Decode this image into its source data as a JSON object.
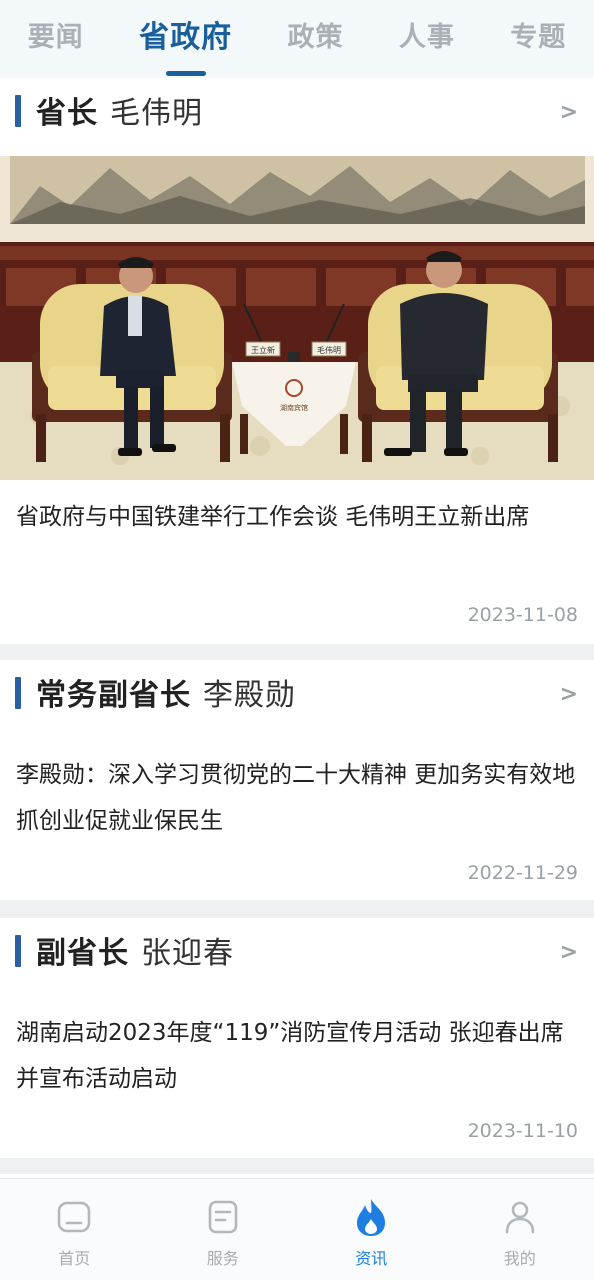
{
  "tabs": [
    {
      "label": "要闻"
    },
    {
      "label": "省政府",
      "active": true
    },
    {
      "label": "政策"
    },
    {
      "label": "人事"
    },
    {
      "label": "专题"
    }
  ],
  "cards": [
    {
      "role": "省长",
      "name": "毛伟明",
      "chevron": ">",
      "title": "省政府与中国铁建举行工作会谈 毛伟明王立新出席",
      "date": "2023-11-08",
      "photo": {
        "nameplate_left": "王立新",
        "nameplate_right": "毛伟明",
        "banner": "湖南宾馆"
      }
    },
    {
      "role": "常务副省长",
      "name": "李殿勋",
      "chevron": ">",
      "title": "李殿勋：深入学习贯彻党的二十大精神 更加务实有效地抓创业促就业保民生",
      "date": "2022-11-29"
    },
    {
      "role": "副省长",
      "name": "张迎春",
      "chevron": ">",
      "title": "湖南启动2023年度“119”消防宣传月活动 张迎春出席并宣布活动启动",
      "date": "2023-11-10"
    }
  ],
  "bottom_nav": [
    {
      "label": "首页",
      "icon": "home-icon"
    },
    {
      "label": "服务",
      "icon": "service-icon"
    },
    {
      "label": "资讯",
      "icon": "flame-icon",
      "active": true
    },
    {
      "label": "我的",
      "icon": "user-icon"
    }
  ],
  "colors": {
    "accent": "#1a5f9c",
    "bar": "#2c5ea4",
    "active_nav": "#1e7fe0",
    "muted": "#9aa0a6"
  }
}
